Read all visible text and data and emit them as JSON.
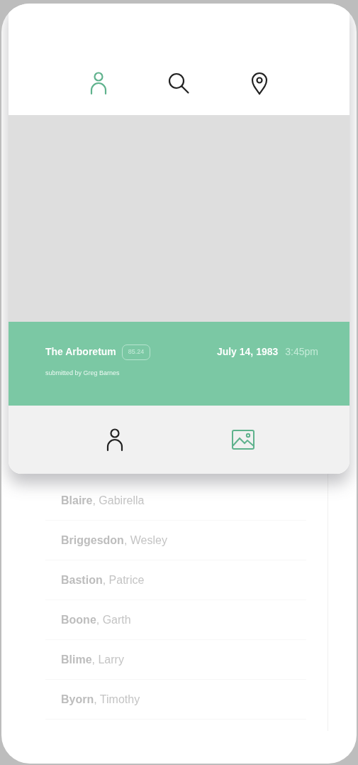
{
  "top_tabs": [
    {
      "kind": "person",
      "selected": true
    },
    {
      "kind": "search",
      "selected": false
    },
    {
      "kind": "location",
      "selected": false
    }
  ],
  "photo_details": {
    "title": "The Arboretum",
    "badge": "85.24",
    "date": "July 14, 1983",
    "time": "3:45pm",
    "submitted": "submitted by Greg Barnes"
  },
  "bottom_tabs": [
    {
      "kind": "person",
      "selected": false
    },
    {
      "kind": "picture",
      "selected": true
    }
  ],
  "contacts": [
    {
      "last": "Blaire",
      "first": ", Gabirella"
    },
    {
      "last": "Briggesdon",
      "first": ", Wesley"
    },
    {
      "last": "Bastion",
      "first": ", Patrice"
    },
    {
      "last": "Boone",
      "first": ", Garth"
    },
    {
      "last": "Blime",
      "first": ", Larry"
    },
    {
      "last": "Byorn",
      "first": ", Timothy"
    }
  ]
}
